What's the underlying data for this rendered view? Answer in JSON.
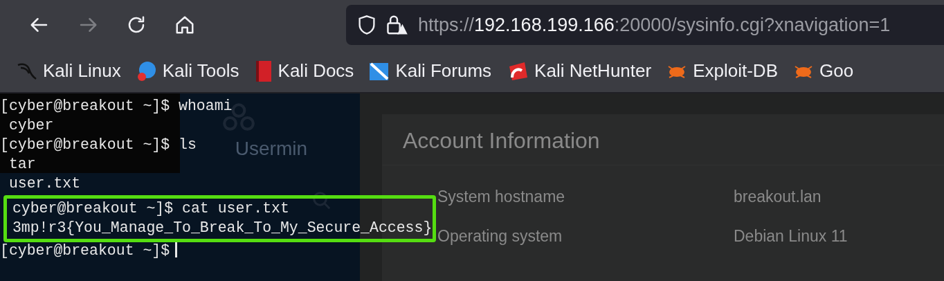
{
  "toolbar": {
    "buttons": [
      {
        "kind": "back",
        "disabled": false
      },
      {
        "kind": "forward",
        "disabled": true
      },
      {
        "kind": "reload",
        "disabled": false
      },
      {
        "kind": "home",
        "disabled": false
      }
    ],
    "url": {
      "scheme": "https://",
      "host": "192.168.199.166",
      "rest": ":20000/sysinfo.cgi?xnavigation=1"
    }
  },
  "bookmarks": [
    {
      "label": "Kali Linux",
      "kind": "dragon"
    },
    {
      "label": "Kali Tools",
      "kind": "tools"
    },
    {
      "label": "Kali Docs",
      "kind": "docs"
    },
    {
      "label": "Kali Forums",
      "kind": "forums"
    },
    {
      "label": "Kali NetHunter",
      "kind": "nethunter"
    },
    {
      "label": "Exploit-DB",
      "kind": "bug"
    },
    {
      "label": "Goo",
      "kind": "bug"
    }
  ],
  "sidebar": {
    "title": "Usermin"
  },
  "page": {
    "title": "Account Information",
    "rows": [
      {
        "label": "System hostname",
        "value": "breakout.lan"
      },
      {
        "label": "Operating system",
        "value": "Debian Linux 11"
      }
    ]
  },
  "terminal": {
    "lines": [
      {
        "text": "[cyber@breakout ~]$ whoami",
        "highlighted": false
      },
      {
        "text": " cyber",
        "highlighted": false
      },
      {
        "text": "[cyber@breakout ~]$ ls",
        "highlighted": false
      },
      {
        "text": " tar",
        "highlighted": false
      },
      {
        "text": " user.txt",
        "highlighted": false
      },
      {
        "text": " cyber@breakout ~]$ cat user.txt",
        "highlighted": true
      },
      {
        "text": " 3mp!r3{You_Manage_To_Break_To_My_Secure_Access}",
        "highlighted": true
      },
      {
        "text": "[cyber@breakout ~]$",
        "highlighted": false,
        "cursor": true
      }
    ]
  }
}
